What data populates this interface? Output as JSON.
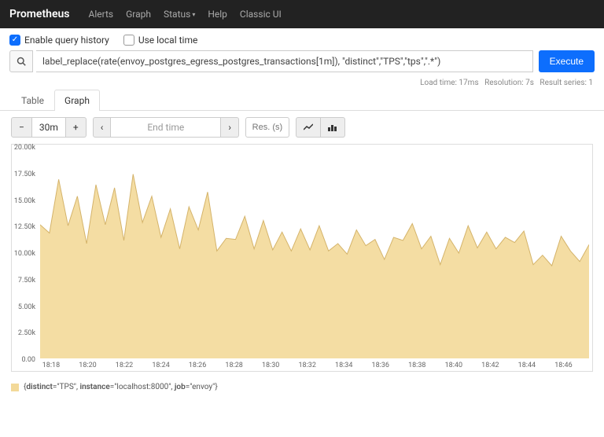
{
  "navbar": {
    "brand": "Prometheus",
    "links": [
      "Alerts",
      "Graph",
      "Status",
      "Help",
      "Classic UI"
    ],
    "status_has_caret": true
  },
  "options": {
    "enable_query_history": {
      "label": "Enable query history",
      "checked": true
    },
    "use_local_time": {
      "label": "Use local time",
      "checked": false
    }
  },
  "query": {
    "value": "label_replace(rate(envoy_postgres_egress_postgres_transactions[1m]), \"distinct\",\"TPS\",\"tps\",\".*\")",
    "execute_label": "Execute"
  },
  "info": {
    "load_time": "Load time: 17ms",
    "resolution": "Resolution: 7s",
    "result_series": "Result series: 1"
  },
  "tabs": {
    "table": "Table",
    "graph": "Graph",
    "active": "Graph"
  },
  "toolbar": {
    "dec": "−",
    "range": "30m",
    "inc": "+",
    "prev": "‹",
    "end_time_placeholder": "End time",
    "next": "›",
    "res_placeholder": "Res. (s)"
  },
  "chart_data": {
    "type": "area",
    "ylabel": "",
    "xlabel": "",
    "ylim": [
      0,
      20000
    ],
    "y_ticks": [
      "20.00k",
      "17.50k",
      "15.00k",
      "12.50k",
      "10.00k",
      "7.50k",
      "5.00k",
      "2.50k",
      "0.00"
    ],
    "x_ticks": [
      "18:18",
      "18:20",
      "18:22",
      "18:24",
      "18:26",
      "18:28",
      "18:30",
      "18:32",
      "18:34",
      "18:36",
      "18:38",
      "18:40",
      "18:42",
      "18:44",
      "18:46"
    ],
    "series": [
      {
        "name": "{distinct=\"TPS\", instance=\"localhost:8000\", job=\"envoy\"}",
        "color": "#f3d999",
        "x": [
          0,
          1,
          2,
          3,
          4,
          5,
          6,
          7,
          8,
          9,
          10,
          11,
          12,
          13,
          14,
          15,
          16,
          17,
          18,
          19,
          20,
          21,
          22,
          23,
          24,
          25,
          26,
          27,
          28,
          29,
          30,
          31,
          32,
          33,
          34,
          35,
          36,
          37,
          38,
          39,
          40,
          41,
          42,
          43,
          44,
          45,
          46,
          47,
          48,
          49,
          50,
          51,
          52,
          53,
          54,
          55,
          56,
          57,
          58,
          59
        ],
        "values": [
          12700,
          11900,
          17000,
          12600,
          15400,
          10900,
          16500,
          12700,
          16200,
          11200,
          17500,
          12900,
          15400,
          11500,
          14200,
          10400,
          14400,
          12200,
          15800,
          10200,
          11400,
          11300,
          13500,
          10400,
          13100,
          10300,
          12000,
          10200,
          12300,
          10300,
          12600,
          10200,
          10900,
          9900,
          12200,
          10700,
          11300,
          9400,
          11500,
          11200,
          12800,
          10400,
          11600,
          8900,
          11400,
          10000,
          12600,
          10500,
          12000,
          10400,
          11500,
          11000,
          12100,
          8900,
          9800,
          8800,
          11600,
          10200,
          9200,
          10800
        ]
      }
    ]
  },
  "legend_prefix": "{",
  "legend_parts": {
    "k1": "distinct",
    "v1": "\"TPS\"",
    "k2": "instance",
    "v2": "\"localhost:8000\"",
    "k3": "job",
    "v3": "\"envoy\""
  },
  "legend_suffix": "}"
}
